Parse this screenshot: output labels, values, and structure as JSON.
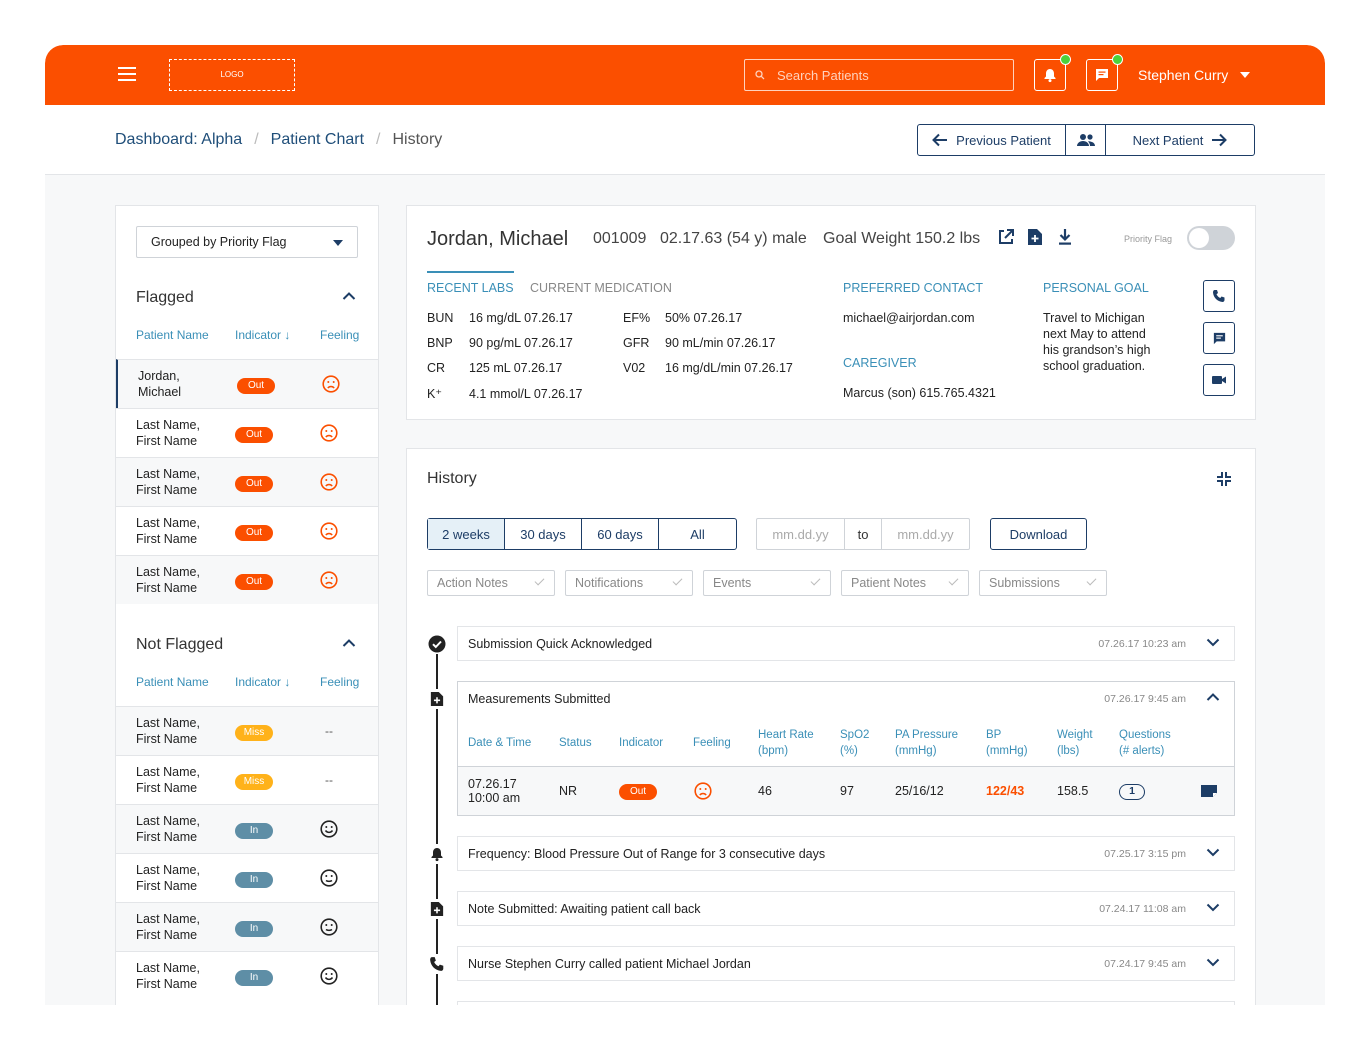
{
  "header": {
    "logo_text": "LOGO",
    "search_placeholder": "Search Patients",
    "user_name": "Stephen Curry"
  },
  "breadcrumb": {
    "items": [
      "Dashboard: Alpha",
      "Patient Chart"
    ],
    "current": "History"
  },
  "nav": {
    "prev_label": "Previous Patient",
    "next_label": "Next Patient"
  },
  "sidebar": {
    "group_select": "Grouped by Priority Flag",
    "flagged_title": "Flagged",
    "not_flagged_title": "Not Flagged",
    "columns": [
      "Patient Name",
      "Indicator",
      "Feeling"
    ],
    "flagged": [
      {
        "name1": "Jordan,",
        "name2": "Michael",
        "indicator": "Out",
        "feeling": "sad"
      },
      {
        "name1": "Last Name,",
        "name2": "First Name",
        "indicator": "Out",
        "feeling": "sad"
      },
      {
        "name1": "Last Name,",
        "name2": "First Name",
        "indicator": "Out",
        "feeling": "sad"
      },
      {
        "name1": "Last Name,",
        "name2": "First Name",
        "indicator": "Out",
        "feeling": "sad"
      },
      {
        "name1": "Last Name,",
        "name2": "First Name",
        "indicator": "Out",
        "feeling": "sad"
      }
    ],
    "not_flagged": [
      {
        "name1": "Last Name,",
        "name2": "First Name",
        "indicator": "Miss",
        "feeling": "--"
      },
      {
        "name1": "Last Name,",
        "name2": "First Name",
        "indicator": "Miss",
        "feeling": "--"
      },
      {
        "name1": "Last Name,",
        "name2": "First Name",
        "indicator": "In",
        "feeling": "happy"
      },
      {
        "name1": "Last Name,",
        "name2": "First Name",
        "indicator": "In",
        "feeling": "neutral"
      },
      {
        "name1": "Last Name,",
        "name2": "First Name",
        "indicator": "In",
        "feeling": "neutral"
      },
      {
        "name1": "Last Name,",
        "name2": "First Name",
        "indicator": "In",
        "feeling": "happy"
      }
    ]
  },
  "patient": {
    "name": "Jordan, Michael",
    "id": "001009",
    "dob": "02.17.63 (54 y) male",
    "goal_weight": "Goal Weight 150.2 lbs",
    "priority_flag_label": "Priority Flag",
    "tabs": [
      "RECENT LABS",
      "CURRENT MEDICATION"
    ],
    "labs_left": [
      {
        "k": "BUN",
        "v": "16 mg/dL  07.26.17"
      },
      {
        "k": "BNP",
        "v": "90 pg/mL  07.26.17"
      },
      {
        "k": "CR",
        "v": "125 mL  07.26.17"
      },
      {
        "k": "K⁺",
        "v": "4.1 mmol/L  07.26.17"
      }
    ],
    "labs_right": [
      {
        "k": "EF%",
        "v": "50%  07.26.17"
      },
      {
        "k": "GFR",
        "v": "90 mL/min  07.26.17"
      },
      {
        "k": "V02",
        "v": "16 mg/dL/min  07.26.17"
      }
    ],
    "preferred_contact_label": "PREFERRED CONTACT",
    "preferred_contact": "michael@airjordan.com",
    "caregiver_label": "CAREGIVER",
    "caregiver": "Marcus (son) 615.765.4321",
    "personal_goal_label": "PERSONAL GOAL",
    "personal_goal_lines": [
      "Travel to Michigan",
      "next May to attend",
      "his grandson’s high",
      "school graduation."
    ]
  },
  "history": {
    "title": "History",
    "ranges": [
      "2 weeks",
      "30 days",
      "60 days",
      "All"
    ],
    "date_from_placeholder": "mm.dd.yy",
    "date_to_label": "to",
    "date_to_placeholder": "mm.dd.yy",
    "download_label": "Download",
    "filters": [
      "Action Notes",
      "Notifications",
      "Events",
      "Patient Notes",
      "Submissions"
    ],
    "events": [
      {
        "title": "Submission Quick Acknowledged",
        "date": "07.26.17 10:23 am",
        "icon": "check-circle-icon"
      },
      {
        "title": "Measurements Submitted",
        "date": "07.26.17 9:45 am",
        "icon": "file-plus-icon"
      },
      {
        "title": "Frequency: Blood Pressure Out of Range for 3 consecutive days",
        "date": "07.25.17 3:15 pm",
        "icon": "bell-icon"
      },
      {
        "title": "Note Submitted: Awaiting patient call back",
        "date": "07.24.17 11:08 am",
        "icon": "file-plus-icon"
      },
      {
        "title": "Nurse Stephen Curry called patient Michael Jordan",
        "date": "07.24.17 9:45 am",
        "icon": "phone-icon"
      }
    ],
    "measure_columns": [
      [
        "Date & Time",
        ""
      ],
      [
        "Status",
        ""
      ],
      [
        "Indicator",
        ""
      ],
      [
        "Feeling",
        ""
      ],
      [
        "Heart Rate",
        "(bpm)"
      ],
      [
        "SpO2",
        "(%)"
      ],
      [
        "PA Pressure",
        "(mmHg)"
      ],
      [
        "BP",
        "(mmHg)"
      ],
      [
        "Weight",
        "(lbs)"
      ],
      [
        "Questions",
        "(# alerts)"
      ]
    ],
    "measure_row": {
      "date": "07.26.17",
      "time": "10:00 am",
      "status": "NR",
      "indicator": "Out",
      "feeling": "sad",
      "heart_rate": "46",
      "spo2": "97",
      "pa_pressure": "25/16/12",
      "bp": "122/43",
      "weight": "158.5",
      "questions": "1"
    }
  },
  "colors": {
    "brand": "#fb4f00",
    "navy": "#1d3d66",
    "accent": "#3a8fb7",
    "miss": "#ffb21a",
    "in": "#5e8ea6",
    "online": "#4cd13a"
  }
}
